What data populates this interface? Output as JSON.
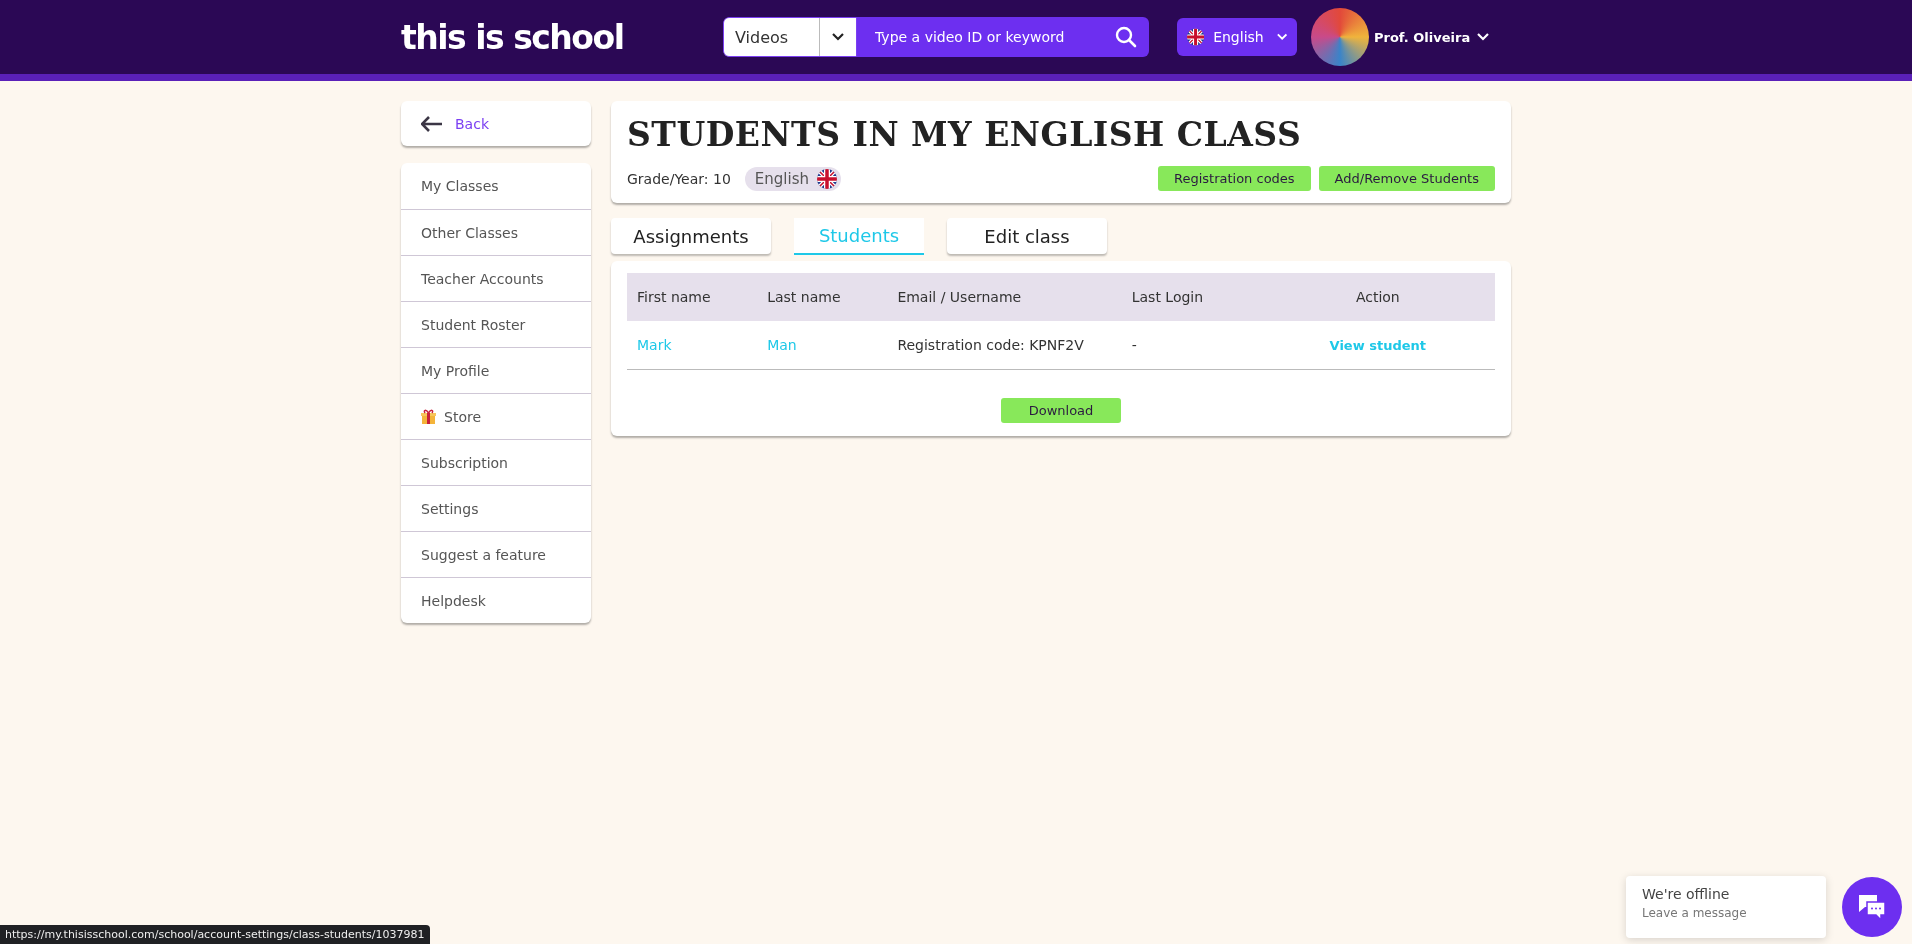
{
  "header": {
    "logo": "this is school",
    "search": {
      "category": "Videos",
      "placeholder": "Type a video ID or keyword"
    },
    "language": "English",
    "user": "Prof. Oliveira"
  },
  "sidebar": {
    "back": "Back",
    "items": [
      {
        "label": "My Classes",
        "kind": "plain"
      },
      {
        "label": "Other Classes",
        "kind": "plain"
      },
      {
        "label": "Teacher Accounts",
        "kind": "plain"
      },
      {
        "label": "Student Roster",
        "kind": "plain"
      },
      {
        "label": "My Profile",
        "kind": "plain"
      },
      {
        "label": "Store",
        "kind": "gift"
      },
      {
        "label": "Subscription",
        "kind": "plain"
      },
      {
        "label": "Settings",
        "kind": "plain"
      },
      {
        "label": "Suggest a feature",
        "kind": "plain"
      },
      {
        "label": "Helpdesk",
        "kind": "plain"
      }
    ]
  },
  "class_card": {
    "title": "STUDENTS IN MY ENGLISH CLASS",
    "grade_label": "Grade/Year:",
    "grade_value": "10",
    "subject": "English",
    "buttons": [
      "Registration codes",
      "Add/Remove Students"
    ]
  },
  "tabs": [
    {
      "label": "Assignments",
      "selected": false
    },
    {
      "label": "Students",
      "selected": true
    },
    {
      "label": "Edit class",
      "selected": false
    }
  ],
  "table": {
    "columns": [
      "First name",
      "Last name",
      "Email / Username",
      "Last Login",
      "Action"
    ],
    "rows": [
      {
        "first_name": "Mark",
        "last_name": "Man",
        "email": "Registration code: KPNF2V",
        "last_login": "-",
        "action": "View student"
      }
    ],
    "download": "Download"
  },
  "chat": {
    "title": "We're offline",
    "subtitle": "Leave a message"
  },
  "status_bar": {
    "url": "https://my.thisisschool.com/school/account-settings/class-students/1037981"
  }
}
